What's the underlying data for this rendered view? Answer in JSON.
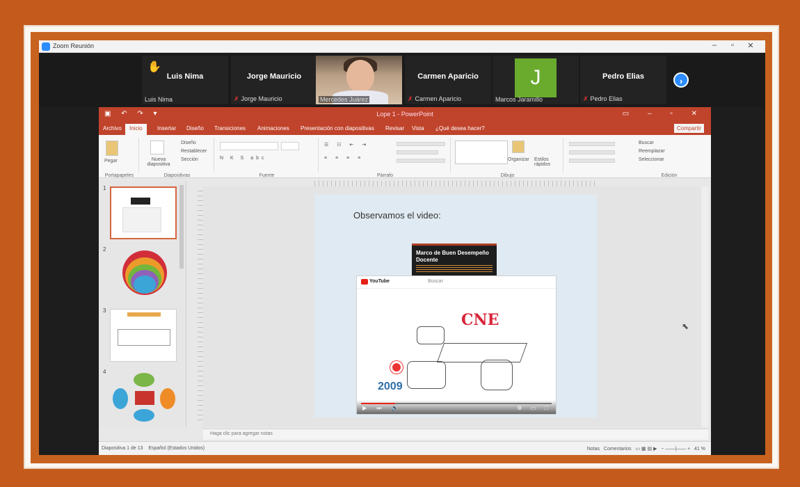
{
  "zoom": {
    "window_title": "Zoom Reunión"
  },
  "participants": [
    {
      "name": "Luis Nima",
      "label": "Luis Nima",
      "muted": false,
      "hand_raised": true
    },
    {
      "name": "Jorge Mauricio",
      "label": "Jorge Mauricio",
      "muted": true
    },
    {
      "name": "",
      "label": "Mercedes Juárez",
      "video": true
    },
    {
      "name": "Carmen Aparicio",
      "label": "Carmen Aparicio",
      "muted": true
    },
    {
      "name": "J",
      "label": "Marcos Jaramillo",
      "avatar_letter": "J",
      "avatar_color": "#6aab2e"
    },
    {
      "name": "Pedro Elias",
      "label": "Pedro Elias",
      "muted": true
    }
  ],
  "ppt": {
    "title": "Lope 1 - PowerPoint",
    "tabs": [
      "Archivo",
      "Inicio",
      "Insertar",
      "Diseño",
      "Transiciones",
      "Animaciones",
      "Presentación con diapositivas",
      "Revisar",
      "Vista",
      "¿Qué desea hacer?"
    ],
    "share": "Compartir",
    "groups": [
      "Portapapeles",
      "Diapositivas",
      "Fuente",
      "Párrafo",
      "Dibujo",
      "Edición"
    ],
    "ribbon_labels": {
      "paste": "Pegar",
      "new_slide": "Nueva diapositiva",
      "layout": "Diseño",
      "reset": "Restablecer",
      "section": "Sección",
      "arrange": "Organizar",
      "quick_styles": "Estilos rápidos",
      "find": "Buscar",
      "replace": "Reemplazar",
      "select": "Seleccionar"
    },
    "thumbnails": [
      "1",
      "2",
      "3",
      "4"
    ],
    "slide_title": "Observamos el video:",
    "video_cover_title": "Marco de Buen Desempeño Docente",
    "youtube_word": "YouTube",
    "youtube_search": "Buscar",
    "video_headline": "CNE",
    "video_year": "2009",
    "notes_placeholder": "Haga clic para agregar notas",
    "status_left": "Diapositiva 1 de 13",
    "status_lang": "Español (Estados Unidos)",
    "status_notes": "Notas",
    "status_comments": "Comentarios",
    "zoom_level": "41 %"
  }
}
